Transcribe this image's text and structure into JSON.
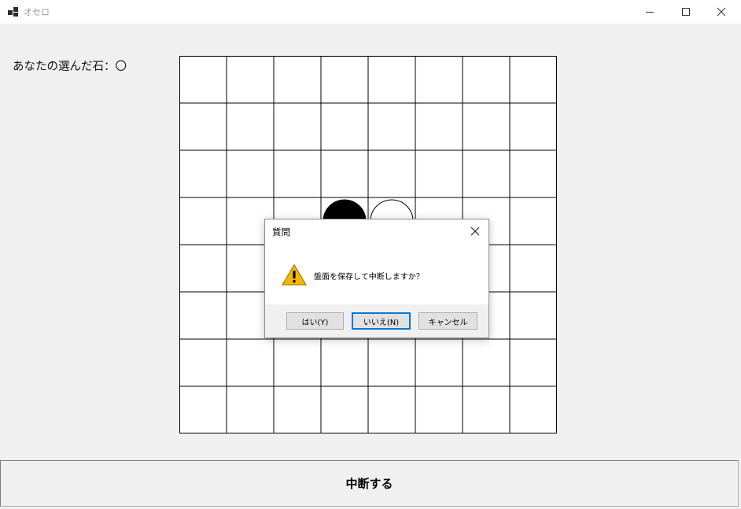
{
  "window": {
    "title": "オセロ",
    "app_icon": "app-icon",
    "controls": [
      "minimize-icon",
      "maximize-icon",
      "close-icon"
    ]
  },
  "main": {
    "choice_label": "あなたの選んだ石：〇",
    "board": {
      "size": 8,
      "stones": [
        {
          "row": 3,
          "col": 3,
          "color": "black"
        },
        {
          "row": 3,
          "col": 4,
          "color": "white"
        }
      ]
    },
    "suspend_button": "中断する"
  },
  "dialog": {
    "title": "質問",
    "icon": "warning-icon",
    "message": "盤面を保存して中断しますか？",
    "buttons": {
      "yes": "はい(Y)",
      "no": "いいえ(N)",
      "cancel": "キャンセル"
    },
    "default_button": "no"
  },
  "colors": {
    "accent": "#0078d7",
    "warning": "#f5b800",
    "background": "#f0f0f0"
  }
}
